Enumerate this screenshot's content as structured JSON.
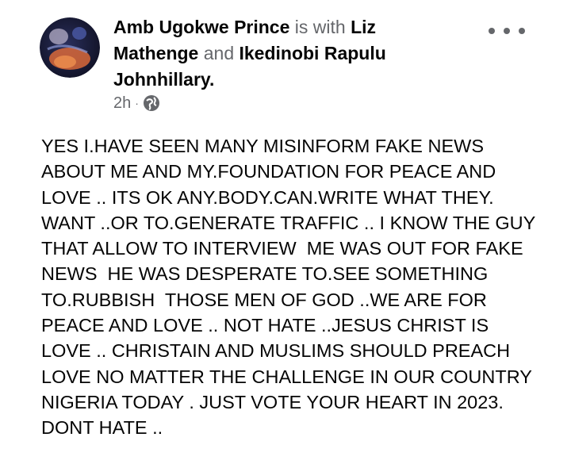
{
  "post": {
    "author": "Amb Ugokwe Prince",
    "with_text": "is with",
    "tagged": [
      "Liz Mathenge",
      "Ikedinobi Rapulu Johnhillary"
    ],
    "and_text": "and",
    "time": "2h",
    "separator": "·",
    "privacy_icon": "globe-icon",
    "more_icon": "more-options-icon",
    "lines": [
      "YES I.HAVE SEEN MANY MISINFORM FAKE NEWS",
      "ABOUT ME AND MY.FOUNDATION FOR PEACE AND",
      "LOVE .. ITS OK ANY.BODY.CAN.WRITE WHAT THEY.",
      "WANT ..OR TO.GENERATE TRAFFIC .. I KNOW THE GUY",
      "THAT ALLOW TO INTERVIEW  ME WAS OUT FOR FAKE",
      "NEWS  HE WAS DESPERATE TO.SEE SOMETHING",
      "TO.RUBBISH  THOSE MEN OF GOD ..WE ARE FOR",
      "PEACE AND LOVE .. NOT HATE ..JESUS CHRIST IS",
      "LOVE .. CHRISTAIN AND MUSLIMS SHOULD PREACH",
      "LOVE NO MATTER THE CHALLENGE IN OUR COUNTRY",
      "NIGERIA TODAY . JUST VOTE YOUR HEART IN 2023.",
      "DONT HATE .."
    ]
  },
  "colors": {
    "text": "#050505",
    "secondary": "#65676b",
    "background": "#ffffff"
  }
}
